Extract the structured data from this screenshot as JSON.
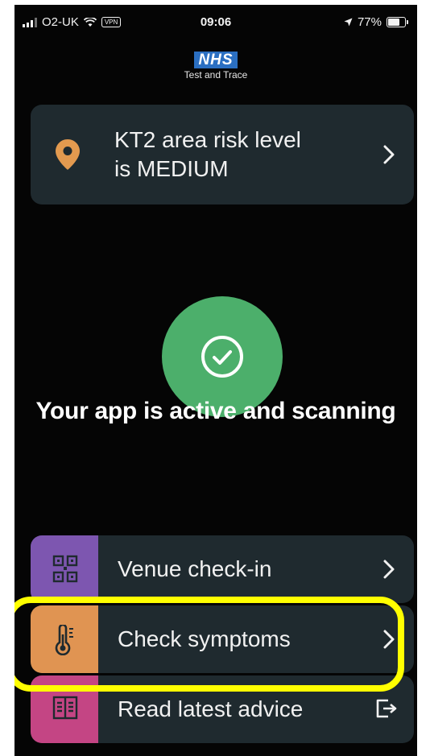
{
  "status_bar": {
    "carrier": "O2-UK",
    "vpn": "VPN",
    "time": "09:06",
    "battery": "77%",
    "battery_level": 0.77
  },
  "logo": {
    "brand": "NHS",
    "subtitle": "Test and Trace"
  },
  "risk_card": {
    "line1": "KT2 area risk level",
    "line2": "is MEDIUM"
  },
  "status_message": "Your app is active and scanning",
  "menu": {
    "venue": {
      "label": "Venue check-in",
      "icon": "qr-code-icon",
      "color": "#7d56b0"
    },
    "symptoms": {
      "label": "Check symptoms",
      "icon": "thermometer-icon",
      "color": "#e09452"
    },
    "advice": {
      "label": "Read latest advice",
      "icon": "book-icon",
      "color": "#c44584"
    }
  },
  "colors": {
    "background": "#050505",
    "card": "#1f2a2f",
    "active_green": "#4caf6b",
    "pin_orange": "#e39a4f",
    "highlight": "#ffff00"
  }
}
